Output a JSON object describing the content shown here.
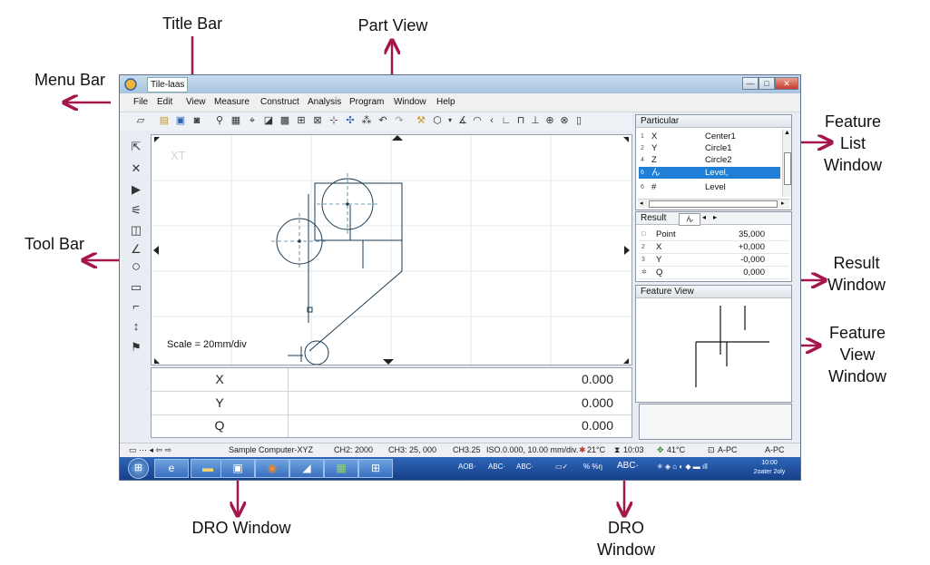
{
  "callouts": {
    "title_bar": "Title Bar",
    "part_view": "Part View",
    "menu_bar": "Menu Bar",
    "tool_bar": "Tool Bar",
    "feature_list_line1": "Feature",
    "feature_list_line2": "List",
    "feature_list_line3": "Window",
    "result_line1": "Result",
    "result_line2": "Window",
    "feature_view_line1": "Feature",
    "feature_view_line2": "View",
    "feature_view_line3": "Window",
    "dro_left": "DRO Window",
    "dro_right_line1": "DRO",
    "dro_right_line2": "Window"
  },
  "window": {
    "title": "Tile-laas",
    "min_glyph": "—",
    "max_glyph": "□",
    "close_glyph": "✕"
  },
  "menu": [
    "File",
    "Edit",
    "View",
    "Measure",
    "Construct",
    "Analysis",
    "Program",
    "Window",
    "Help"
  ],
  "part_view": {
    "axis_label": "XT",
    "scale": "Scale = 20mm/div"
  },
  "dro": {
    "rows": [
      {
        "label": "X",
        "value": "0.000"
      },
      {
        "label": "Y",
        "value": "0.000"
      },
      {
        "label": "Q",
        "value": "0.000"
      }
    ]
  },
  "feature_list": {
    "header": "Particular",
    "rows": [
      {
        "num": "1",
        "code": "X",
        "name": "Center1",
        "selected": false
      },
      {
        "num": "2",
        "code": "Y",
        "name": "Circle1",
        "selected": false
      },
      {
        "num": "4",
        "code": "Z",
        "name": "Circle2",
        "selected": false
      },
      {
        "num": "6",
        "code": "ん",
        "name": "Level,",
        "selected": true
      },
      {
        "num": "6",
        "code": "#",
        "name": "Level",
        "selected": false
      }
    ]
  },
  "result": {
    "header": "Result",
    "tab": "ん",
    "rows": [
      {
        "num": "□",
        "code": "Point",
        "value": "35,000"
      },
      {
        "num": "2",
        "code": "X",
        "value": "+0,000"
      },
      {
        "num": "3",
        "code": "Y",
        "value": "-0,000"
      },
      {
        "num": "✲",
        "code": "Q",
        "value": "0,000"
      }
    ]
  },
  "feature_view": {
    "header": "Feature View"
  },
  "status": {
    "computer": "Sample Computer-XYZ",
    "ch2": "CH2: 2000",
    "ch3": "CH3: 25, 000",
    "ch3b": "CH3.25",
    "iso": "ISO.0.000, 10.00 mm/div.",
    "temp1": "21°C",
    "time": "10:03",
    "temp2": "41°C",
    "pc1": "A-PC",
    "pc2": "A-PC"
  },
  "taskbar": {
    "tray1": "AOB·",
    "tray2": "ABC·",
    "tray3": "ABC·",
    "tray4": "% %ŋ",
    "tray5": "ABC·",
    "clock_time": "10:00",
    "clock_date": "2oater 2oly"
  },
  "colors": {
    "arrow": "#a3174d",
    "selection": "#1f7fd6",
    "geometry": "#1a3a52"
  }
}
